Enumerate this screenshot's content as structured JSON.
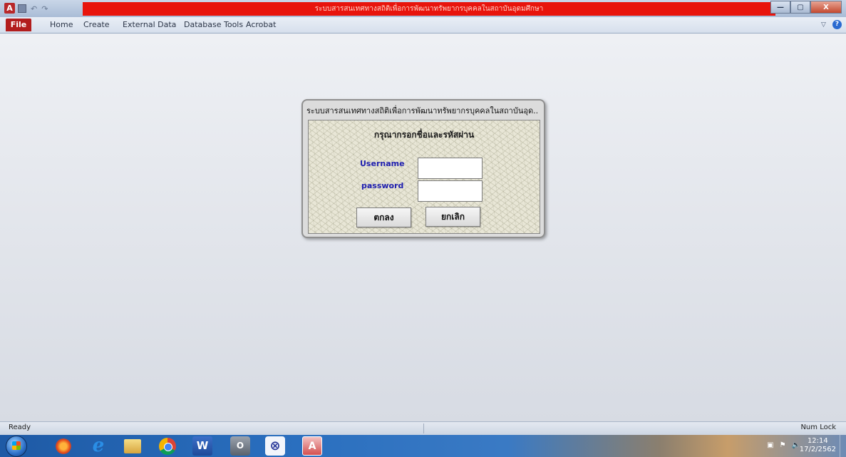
{
  "window": {
    "title": "ระบบสารสนเทศทางสถิติเพื่อการพัฒนาทรัพยากรบุคคลในสถาบันอุดมศึกษา",
    "app_icon_label": "A",
    "buttons": {
      "minimize": "—",
      "maximize": "▢",
      "close": "X"
    }
  },
  "ribbon": {
    "file_tab": "File",
    "tabs": [
      "Home",
      "Create",
      "External Data",
      "Database Tools",
      "Acrobat"
    ],
    "minimize_icon": "▽",
    "help_icon": "?"
  },
  "login_dialog": {
    "title": "ระบบสารสนเทศทางสถิติเพื่อการพัฒนาทรัพยากรบุคคลในสถาบันอุด..",
    "heading": "กรุณากรอกชื่อและรหัสผ่าน",
    "username_label": "Username",
    "password_label": "password",
    "username_value": "",
    "password_value": "",
    "ok_button": "ตกลง",
    "cancel_button": "ยกเลิก",
    "label_color": "#2020b0"
  },
  "statusbar": {
    "left": "Ready",
    "right": "Num Lock"
  },
  "taskbar": {
    "icons": [
      "start-icon",
      "firefox-icon",
      "internet-explorer-icon",
      "file-explorer-icon",
      "chrome-icon",
      "word-icon",
      "camera-app-icon",
      "app-icon",
      "access-icon"
    ],
    "word_label": "W",
    "camera_label": "O",
    "app_label": "⊗",
    "access_label": "A",
    "ie_label": "e",
    "tray_icons": [
      "network-icon",
      "flag-icon",
      "speaker-icon"
    ],
    "time": "12:14",
    "date": "17/2/2562"
  },
  "colors": {
    "title_red": "#e8140c",
    "file_tab": "#b21d1d"
  }
}
